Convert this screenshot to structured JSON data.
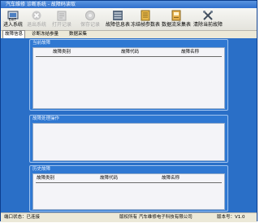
{
  "window": {
    "title": "汽车维修 诊断系统 - 故障码读取"
  },
  "toolbar": {
    "items": [
      {
        "label": "进入系统",
        "icon": "enter-icon",
        "disabled": false
      },
      {
        "label": "退出系统",
        "icon": "exit-icon",
        "disabled": true
      },
      {
        "label": "打开记录",
        "icon": "open-icon",
        "disabled": true
      },
      {
        "label": "保存记录",
        "icon": "save-icon",
        "disabled": true
      },
      {
        "label": "故障信息表",
        "icon": "list-icon",
        "disabled": false
      },
      {
        "label": "冻结帧参数表",
        "icon": "table-icon",
        "disabled": false
      },
      {
        "label": "数据流采集表",
        "icon": "data-icon",
        "disabled": false
      },
      {
        "label": "清除当前故障",
        "icon": "clear-icon",
        "disabled": false
      }
    ]
  },
  "tabs": [
    {
      "label": "故障信息",
      "active": true
    },
    {
      "label": "诊断冻结参量",
      "active": false
    },
    {
      "label": "数据采集",
      "active": false
    }
  ],
  "groups": {
    "current": {
      "title": "当前故障",
      "columns": [
        "故障类别",
        "故障代码",
        "故障名称"
      ]
    },
    "handling": {
      "title": "故障处理操作"
    },
    "history": {
      "title": "历史故障",
      "columns": [
        "故障类别",
        "故障代码",
        "故障名称"
      ]
    }
  },
  "status": {
    "left": "端口状态：已连接",
    "right": "版权所有 汽车维修电子科技有限公司",
    "version": "版本号：V1.0"
  },
  "colors": {
    "window_bg": "#2a6fc7",
    "panel_bg": "#f4f4f8",
    "toolbar_bg": "#e9e8e1"
  }
}
